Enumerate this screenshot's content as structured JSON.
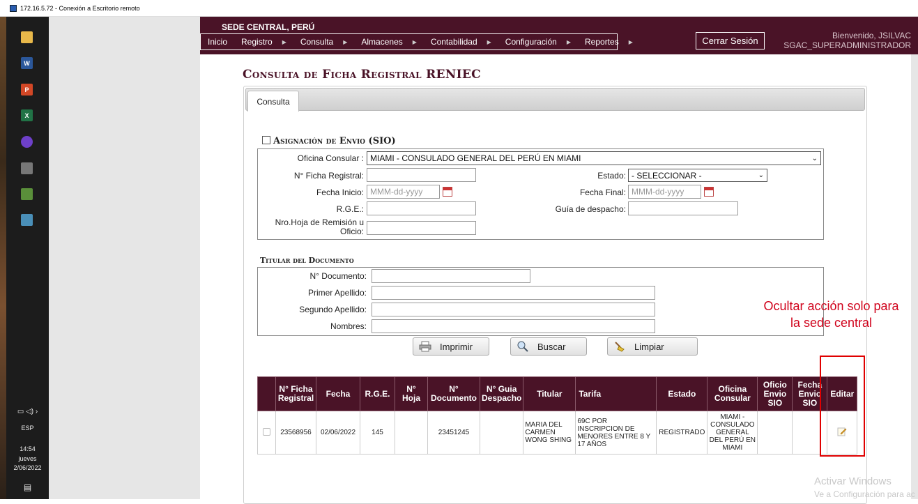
{
  "rdp": {
    "title": "172.16.5.72 - Conexión a Escritorio remoto"
  },
  "taskbar": {
    "lang": "ESP",
    "time": "14:54",
    "day": "jueves",
    "date": "2/06/2022"
  },
  "header": {
    "sede": "SEDE CENTRAL, PERÚ",
    "menu": [
      "Inicio",
      "Registro",
      "Consulta",
      "Almacenes",
      "Contabilidad",
      "Configuración",
      "Reportes"
    ],
    "logout_label": "Cerrar Sesión",
    "welcome": "Bienvenido, JSILVAC",
    "role": "SGAC_SUPERADMINISTRADOR"
  },
  "page": {
    "title": "Consulta de Ficha Registral RENIEC",
    "tab": "Consulta"
  },
  "envio": {
    "title": "Asignación de Envio (SIO)",
    "oficina_label": "Oficina Consular :",
    "oficina_value": "MIAMI - CONSULADO GENERAL DEL PERÚ EN MIAMI",
    "ficha_label": "N° Ficha Registral:",
    "estado_label": "Estado:",
    "estado_value": "- SELECCIONAR -",
    "fecha_inicio_label": "Fecha Inicio:",
    "fecha_final_label": "Fecha Final:",
    "date_placeholder": "MMM-dd-yyyy",
    "rge_label": "R.G.E.:",
    "guia_label": "Guía de despacho:",
    "hoja_label_1": "Nro.Hoja de Remisión u",
    "hoja_label_2": "Oficio:"
  },
  "titular": {
    "title": "Titular del Documento",
    "documento_label": "N° Documento:",
    "primer_label": "Primer Apellido:",
    "segundo_label": "Segundo Apellido:",
    "nombres_label": "Nombres:"
  },
  "buttons": {
    "print": "Imprimir",
    "search": "Buscar",
    "clear": "Limpiar"
  },
  "table": {
    "headers": [
      "",
      "N° Ficha Registral",
      "Fecha",
      "R.G.E.",
      "N° Hoja",
      "N° Documento",
      "N° Guia Despacho",
      "Titular",
      "Tarifa",
      "Estado",
      "Oficina Consular",
      "Oficio Envio SIO",
      "Fecha Envio SIO",
      "Editar"
    ],
    "rows": [
      {
        "ficha": "23568956",
        "fecha": "02/06/2022",
        "rge": "145",
        "hoja": "",
        "documento": "23451245",
        "guia": "",
        "titular": "MARIA DEL CARMEN WONG SHING",
        "tarifa": "69C POR INSCRIPCION DE MENORES ENTRE 8 Y 17 AÑOS",
        "estado": "REGISTRADO",
        "oficina": "MIAMI - CONSULADO GENERAL DEL PERÚ EN MIAMI",
        "oficio_sio": "",
        "fecha_sio": ""
      }
    ]
  },
  "annotation": {
    "note": "Ocultar acción solo para la sede central"
  },
  "watermark": {
    "line1": "Activar Windows",
    "line2": "Ve a Configuración para ac"
  },
  "colors": {
    "brand": "#4a1327",
    "annotation": "#d0021b"
  },
  "icons": [
    "printer-icon",
    "search-icon",
    "broom-icon",
    "calendar-icon",
    "edit-icon"
  ]
}
